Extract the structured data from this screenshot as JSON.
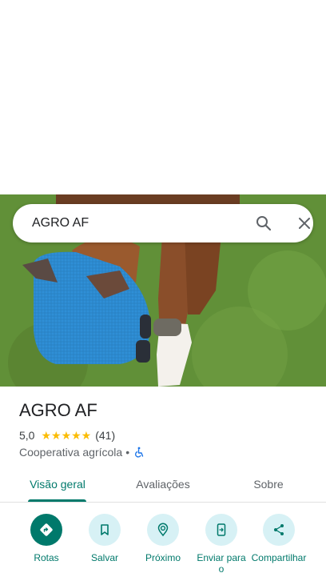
{
  "search": {
    "query": "AGRO AF"
  },
  "place": {
    "name": "AGRO AF",
    "rating": "5,0",
    "stars": "★★★★★",
    "review_count": "(41)",
    "category": "Cooperativa agrícola",
    "separator": "•"
  },
  "tabs": [
    {
      "label": "Visão geral",
      "active": true
    },
    {
      "label": "Avaliações",
      "active": false
    },
    {
      "label": "Sobre",
      "active": false
    }
  ],
  "actions": [
    {
      "label": "Rotas",
      "icon": "directions-icon"
    },
    {
      "label": "Salvar",
      "icon": "bookmark-icon"
    },
    {
      "label": "Próximo",
      "icon": "nearby-icon"
    },
    {
      "label": "Enviar para o",
      "icon": "send-to-phone-icon"
    },
    {
      "label": "Compartilhar",
      "icon": "share-icon"
    }
  ],
  "colors": {
    "accent": "#00796b",
    "action_bg": "#d7f1f5",
    "star": "#fbbc04"
  }
}
